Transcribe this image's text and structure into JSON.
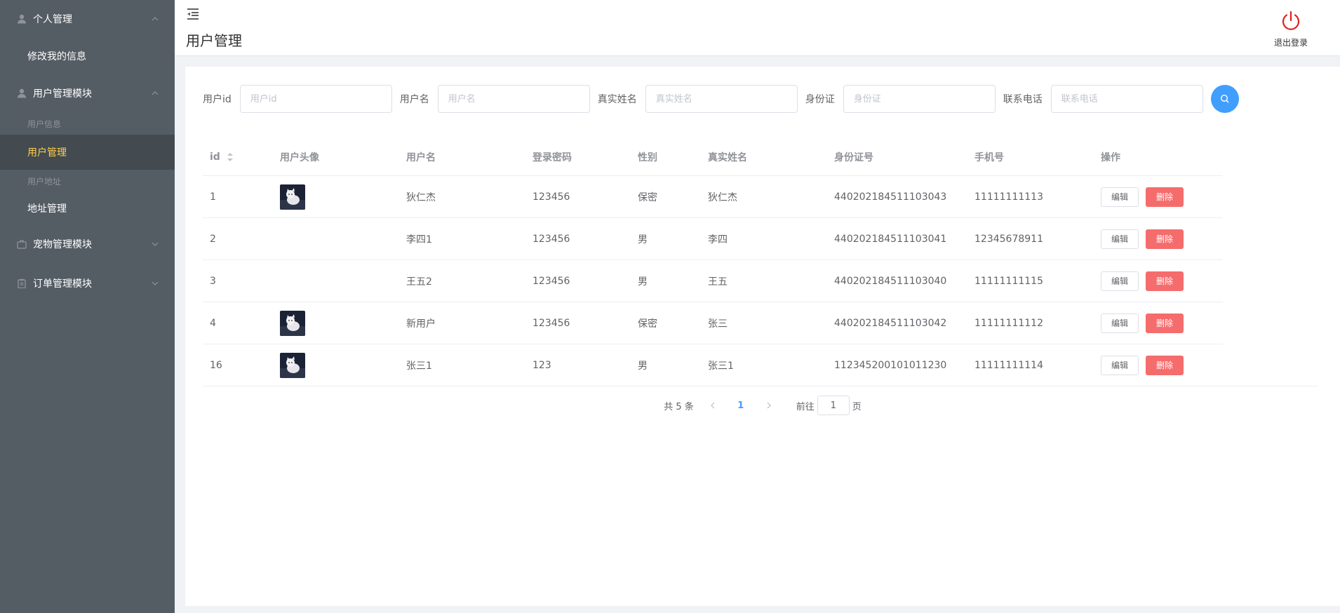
{
  "sidebar": {
    "sections": [
      {
        "title": "个人管理",
        "icon": "user-icon",
        "expanded": true,
        "items": [
          {
            "label": "修改我的信息"
          }
        ]
      },
      {
        "title": "用户管理模块",
        "icon": "user-icon",
        "expanded": true,
        "groups": [
          {
            "group_title": "用户信息",
            "items": [
              {
                "label": "用户管理",
                "active": true
              }
            ]
          },
          {
            "group_title": "用户地址",
            "items": [
              {
                "label": "地址管理"
              }
            ]
          }
        ]
      },
      {
        "title": "宠物管理模块",
        "icon": "briefcase-icon",
        "expanded": false
      },
      {
        "title": "订单管理模块",
        "icon": "clipboard-icon",
        "expanded": false
      }
    ],
    "active_color": "#ffd04b",
    "background": "#545c64"
  },
  "header": {
    "title": "用户管理",
    "logout_label": "退出登录",
    "logout_color": "#e02020"
  },
  "search": {
    "fields": [
      {
        "label": "用户id",
        "placeholder": "用户id"
      },
      {
        "label": "用户名",
        "placeholder": "用户名"
      },
      {
        "label": "真实姓名",
        "placeholder": "真实姓名"
      },
      {
        "label": "身份证",
        "placeholder": "身份证"
      },
      {
        "label": "联系电话",
        "placeholder": "联系电话"
      }
    ],
    "button_icon": "search-icon",
    "button_color": "#409eff"
  },
  "table": {
    "columns": [
      "id",
      "用户头像",
      "用户名",
      "登录密码",
      "性别",
      "真实姓名",
      "身份证号",
      "手机号",
      "操作"
    ],
    "rows": [
      {
        "id": "1",
        "has_avatar": true,
        "username": "狄仁杰",
        "password": "123456",
        "gender": "保密",
        "realname": "狄仁杰",
        "idcard": "440202184511103043",
        "phone": "11111111113"
      },
      {
        "id": "2",
        "has_avatar": false,
        "username": "李四1",
        "password": "123456",
        "gender": "男",
        "realname": "李四",
        "idcard": "440202184511103041",
        "phone": "12345678911"
      },
      {
        "id": "3",
        "has_avatar": false,
        "username": "王五2",
        "password": "123456",
        "gender": "男",
        "realname": "王五",
        "idcard": "440202184511103040",
        "phone": "11111111115"
      },
      {
        "id": "4",
        "has_avatar": true,
        "username": "新用户",
        "password": "123456",
        "gender": "保密",
        "realname": "张三",
        "idcard": "440202184511103042",
        "phone": "11111111112"
      },
      {
        "id": "16",
        "has_avatar": true,
        "username": "张三1",
        "password": "123",
        "gender": "男",
        "realname": "张三1",
        "idcard": "112345200101011230",
        "phone": "11111111114"
      }
    ],
    "edit_label": "编辑",
    "delete_label": "删除",
    "delete_color": "#f56c6c"
  },
  "pagination": {
    "total_text": "共 5 条",
    "current_page": "1",
    "jump_prefix": "前往",
    "jump_value": "1",
    "jump_suffix": "页"
  }
}
